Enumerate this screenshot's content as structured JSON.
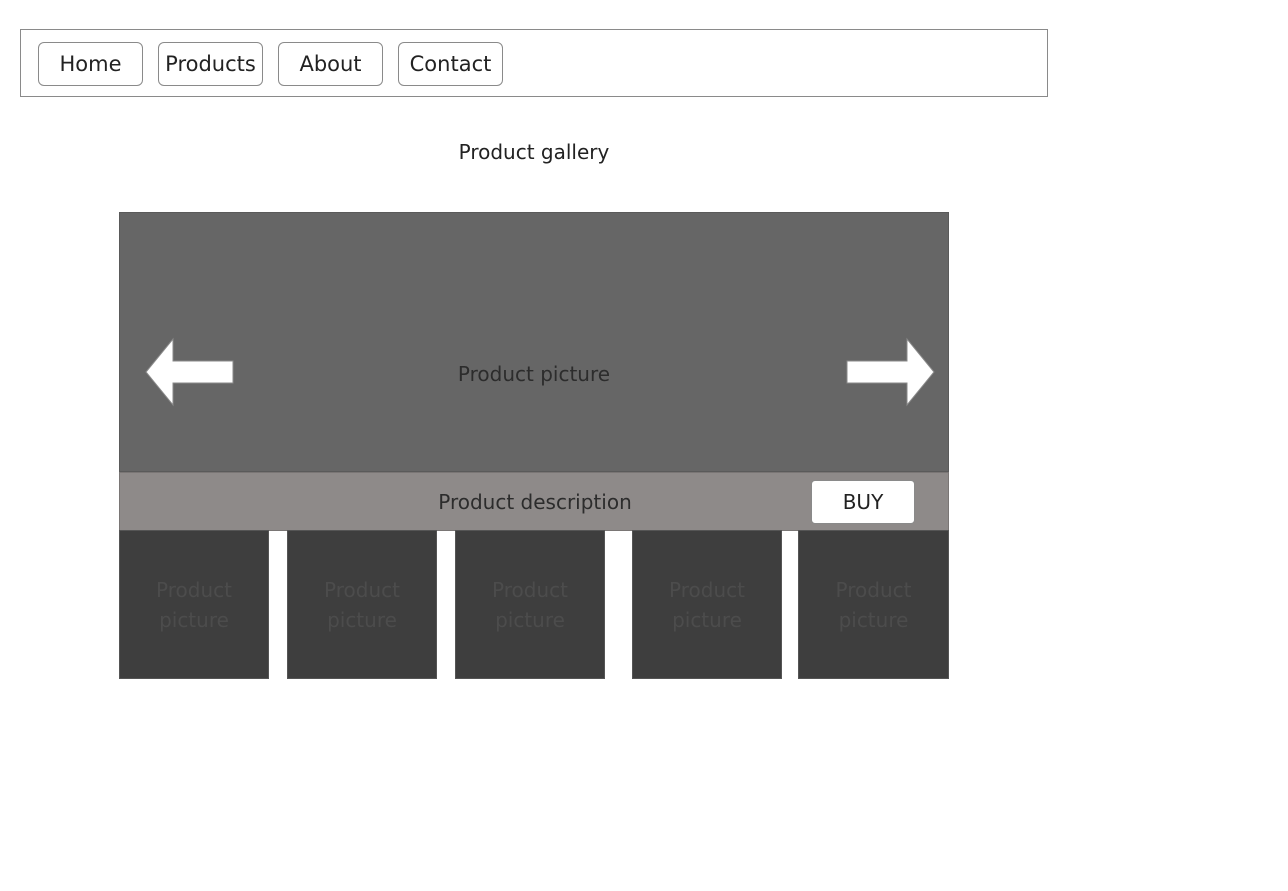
{
  "nav": {
    "items": [
      {
        "label": "Home"
      },
      {
        "label": "Products"
      },
      {
        "label": "About"
      },
      {
        "label": "Contact"
      }
    ]
  },
  "page": {
    "title": "Product gallery"
  },
  "gallery": {
    "main_picture_label": "Product picture",
    "prev_arrow_icon": "arrow-left-icon",
    "next_arrow_icon": "arrow-right-icon",
    "description_label": "Product description",
    "buy_label": "BUY",
    "thumbnails": [
      {
        "line1": "Product",
        "line2": "picture"
      },
      {
        "line1": "Product",
        "line2": "picture"
      },
      {
        "line1": "Product",
        "line2": "picture"
      },
      {
        "line1": "Product",
        "line2": "picture"
      },
      {
        "line1": "Product",
        "line2": "picture"
      }
    ]
  },
  "colors": {
    "hero_background": "#666666",
    "description_background": "#8e8a89",
    "thumbnail_background": "#3e3e3e",
    "border": "#8a8a8a"
  }
}
